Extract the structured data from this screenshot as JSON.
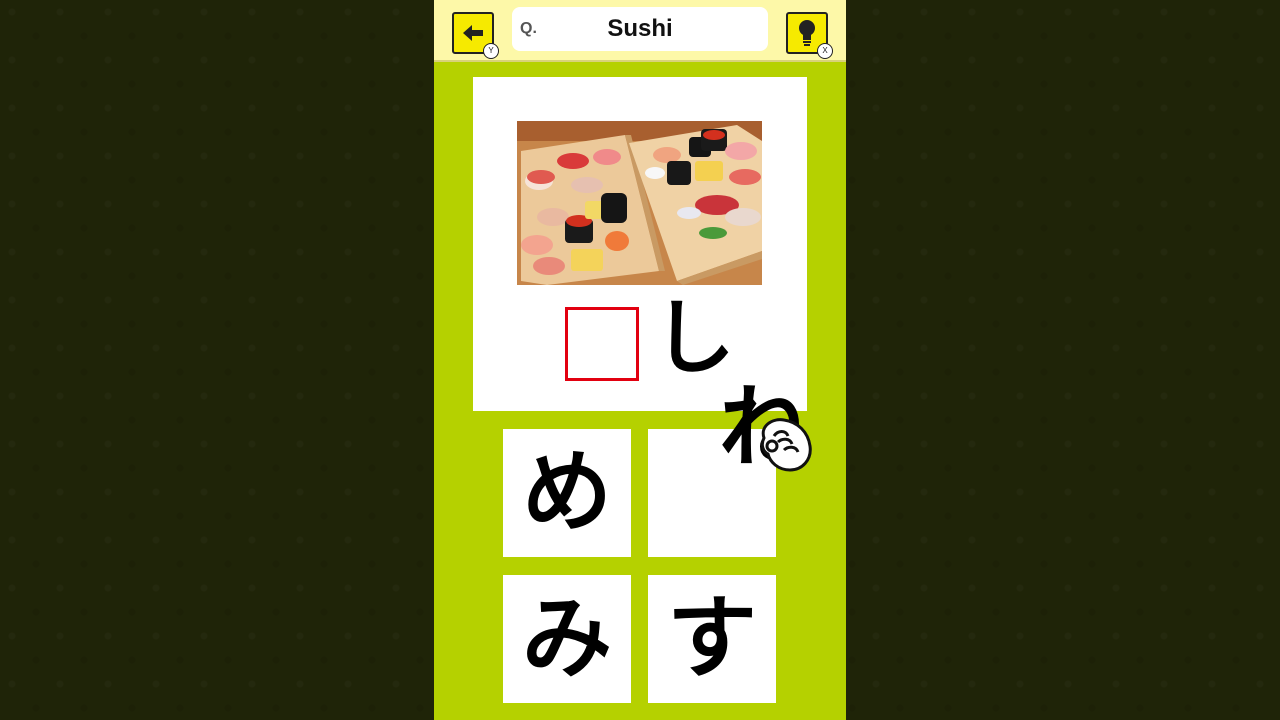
{
  "header": {
    "back_button": {
      "icon": "arrow-left-icon",
      "button_badge": "Y"
    },
    "hint_button": {
      "icon": "lightbulb-icon",
      "button_badge": "X"
    },
    "question_prefix": "Q.",
    "question_title": "Sushi"
  },
  "card": {
    "image": "sushi-photo",
    "answer_filled": "し"
  },
  "choices": [
    {
      "char": "め"
    },
    {
      "char": ""
    },
    {
      "char": "み"
    },
    {
      "char": "す"
    }
  ],
  "dragging": {
    "char": "ね",
    "cursor_icon": "grab-hand-icon"
  },
  "colors": {
    "panel_green": "#b5d100",
    "header_yellow": "#fdf8a8",
    "button_yellow": "#f6ea00",
    "answer_box_red": "#e20010",
    "outer_background": "#1f2408"
  }
}
